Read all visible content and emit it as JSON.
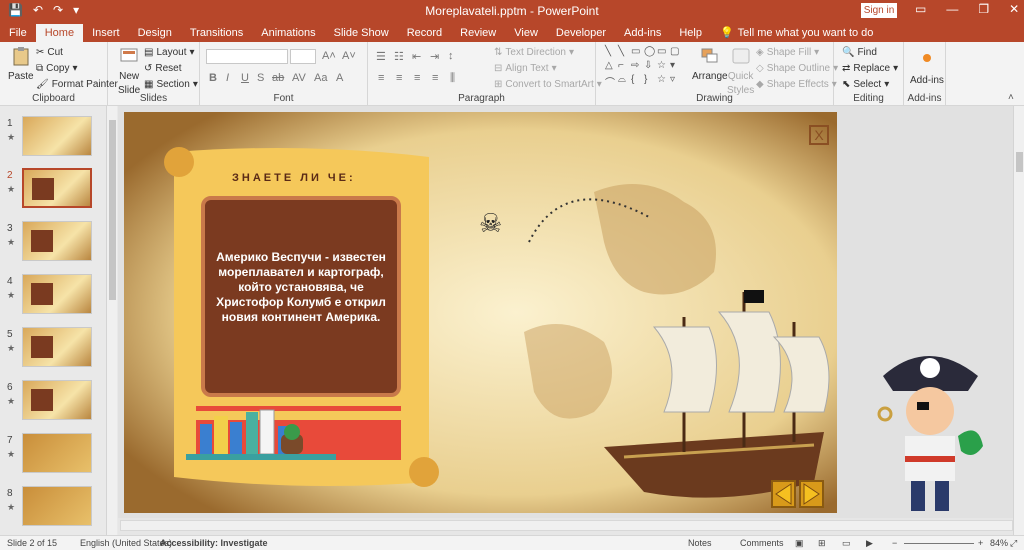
{
  "app": {
    "title": "Moreplavateli.pptm - PowerPoint",
    "sign_in": "Sign in"
  },
  "tabs": [
    "File",
    "Home",
    "Insert",
    "Design",
    "Transitions",
    "Animations",
    "Slide Show",
    "Record",
    "Review",
    "View",
    "Developer",
    "Add-ins",
    "Help"
  ],
  "tell_me": "Tell me what you want to do",
  "ribbon": {
    "clipboard": {
      "label": "Clipboard",
      "paste": "Paste",
      "cut": "Cut",
      "copy": "Copy",
      "format_painter": "Format Painter"
    },
    "slides": {
      "label": "Slides",
      "new_slide_1": "New",
      "new_slide_2": "Slide",
      "layout": "Layout",
      "reset": "Reset",
      "section": "Section"
    },
    "font": {
      "label": "Font"
    },
    "paragraph": {
      "label": "Paragraph",
      "text_direction": "Text Direction",
      "align_text": "Align Text",
      "smartart": "Convert to SmartArt"
    },
    "drawing": {
      "label": "Drawing",
      "arrange": "Arrange",
      "quick_styles_1": "Quick",
      "quick_styles_2": "Styles",
      "shape_fill": "Shape Fill",
      "shape_outline": "Shape Outline",
      "shape_effects": "Shape Effects"
    },
    "editing": {
      "label": "Editing",
      "find": "Find",
      "replace": "Replace",
      "select": "Select"
    },
    "addins": {
      "label": "Add-ins",
      "addins_btn": "Add-ins"
    }
  },
  "thumbnails": [
    "1",
    "2",
    "3",
    "4",
    "5",
    "6",
    "7",
    "8"
  ],
  "slide": {
    "heading": "ЗНАЕТЕ ЛИ ЧЕ:",
    "fact": "Америко Веспучи - известен мореплавател и картограф, който установява, че Христофор Колумб е открил новия континент Америка.",
    "close": "X"
  },
  "status": {
    "slide_of": "Slide 2 of 15",
    "language": "English (United States)",
    "accessibility": "Accessibility: Investigate",
    "notes": "Notes",
    "comments": "Comments",
    "zoom": "84%"
  },
  "colors": {
    "accent": "#b7472a",
    "fact_box": "#7b3a20"
  }
}
